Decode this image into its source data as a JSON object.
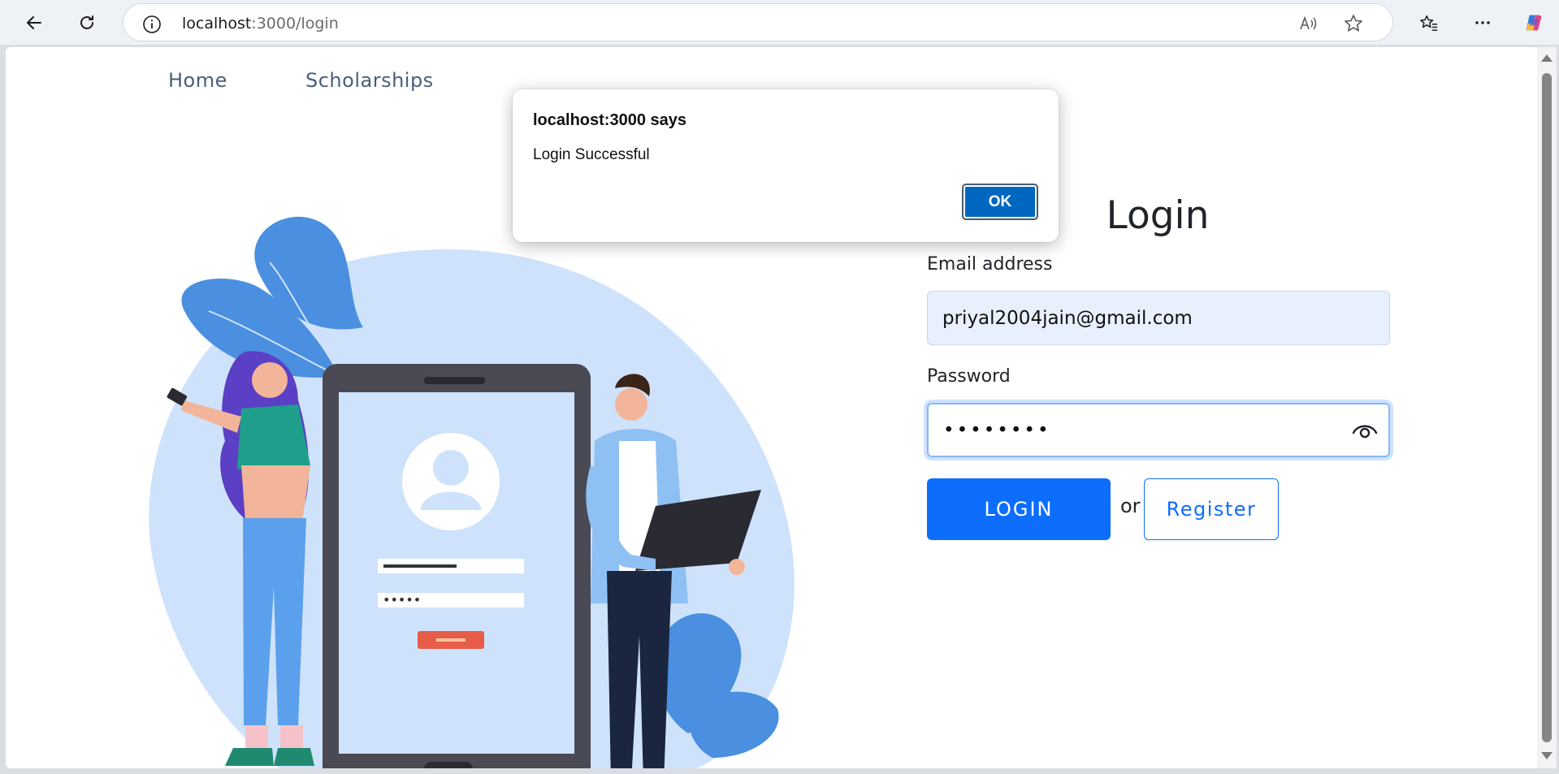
{
  "browser": {
    "url_host": "localhost",
    "url_path": ":3000/login"
  },
  "nav": {
    "home": "Home",
    "scholarships": "Scholarships"
  },
  "login": {
    "title": "Login",
    "email_label": "Email address",
    "email_value": "priyal2004jain@gmail.com",
    "password_label": "Password",
    "password_masked": "••••••••",
    "login_button": "LOGIN",
    "or_text": "or",
    "register_button": "Register"
  },
  "illustration": {
    "password_dots": "•••••"
  },
  "dialog": {
    "title": "localhost:3000 says",
    "message": "Login Successful",
    "ok_button": "OK"
  },
  "colors": {
    "primary": "#0d6efd",
    "email_autofill_bg": "#e8f0fe",
    "illustration_bg": "#cfe2fb",
    "dialog_ok": "#0067c0"
  },
  "icons": [
    "back-icon",
    "reload-icon",
    "info-icon",
    "read-aloud-icon",
    "star-icon",
    "favorites-icon",
    "more-icon",
    "copilot-icon",
    "eye-icon"
  ]
}
